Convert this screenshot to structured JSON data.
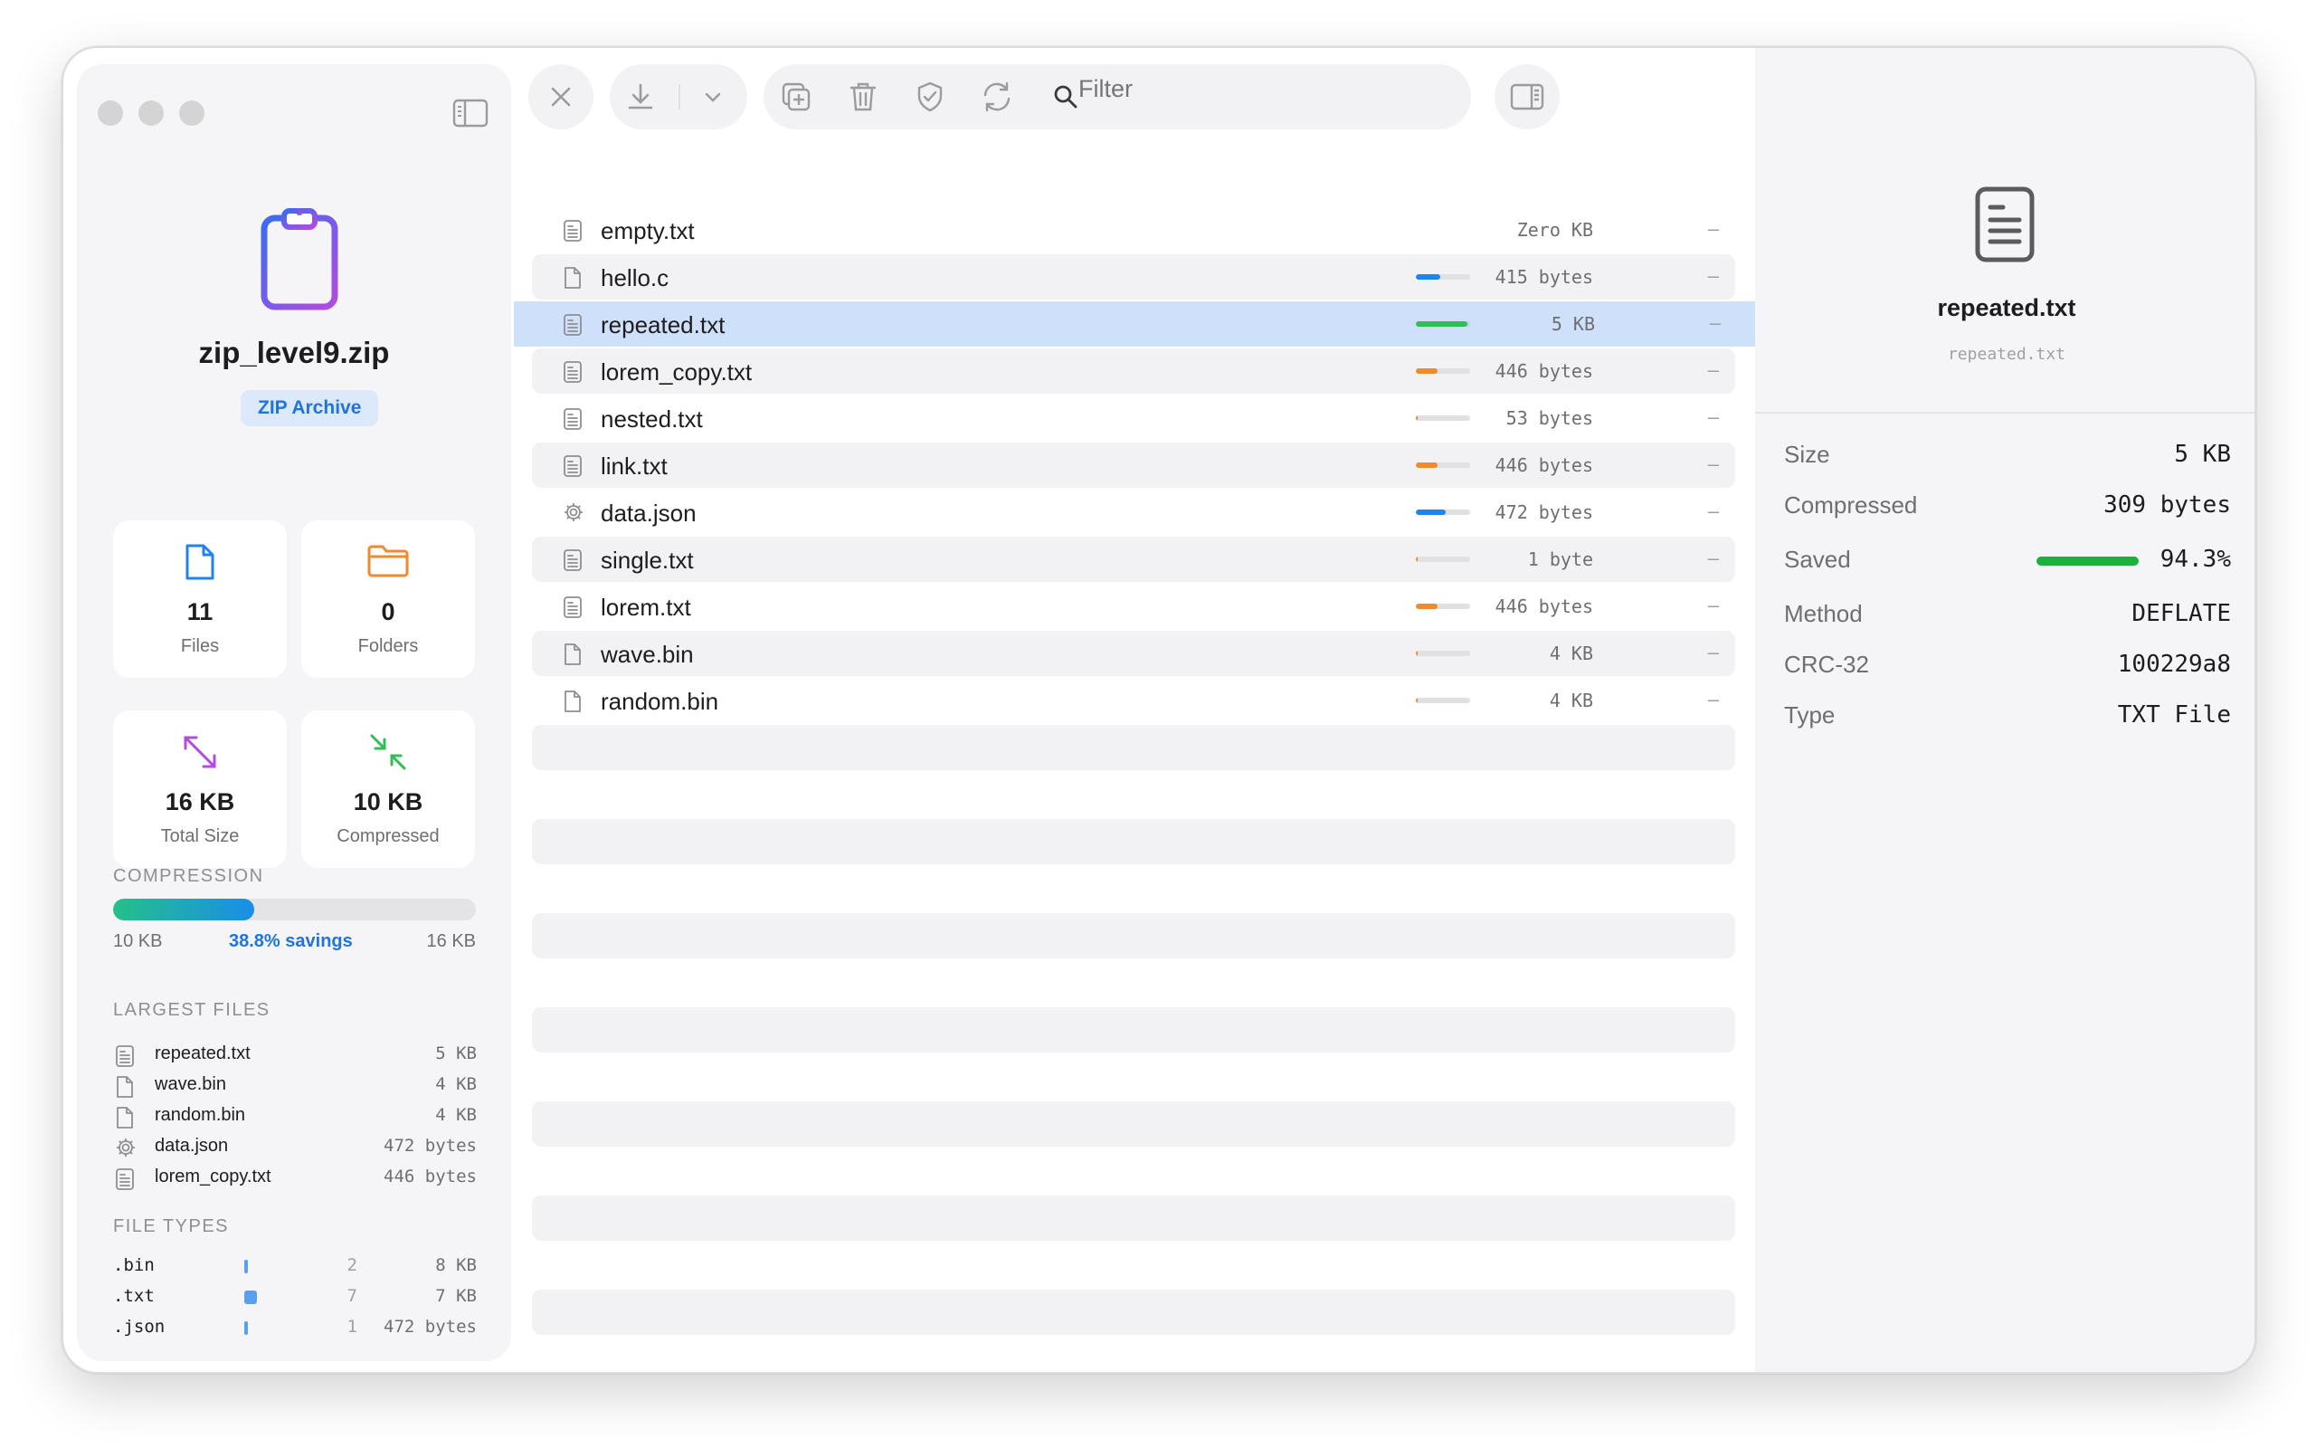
{
  "archive": {
    "name": "zip_level9.zip",
    "badge": "ZIP Archive"
  },
  "stats": [
    {
      "value": "11",
      "label": "Files",
      "icon": "file-icon"
    },
    {
      "value": "0",
      "label": "Folders",
      "icon": "folder-icon"
    },
    {
      "value": "16 KB",
      "label": "Total Size",
      "icon": "expand-arrows-icon"
    },
    {
      "value": "10 KB",
      "label": "Compressed",
      "icon": "compress-arrows-icon"
    }
  ],
  "compression": {
    "heading": "COMPRESSION",
    "left": "10 KB",
    "savings": "38.8% savings",
    "right": "16 KB",
    "fraction": 0.388
  },
  "largest": {
    "heading": "LARGEST FILES",
    "items": [
      {
        "name": "repeated.txt",
        "size": "5 KB",
        "icon": "text-file-icon"
      },
      {
        "name": "wave.bin",
        "size": "4 KB",
        "icon": "file-icon"
      },
      {
        "name": "random.bin",
        "size": "4 KB",
        "icon": "file-icon"
      },
      {
        "name": "data.json",
        "size": "472 bytes",
        "icon": "gear-icon"
      },
      {
        "name": "lorem_copy.txt",
        "size": "446 bytes",
        "icon": "text-file-icon"
      }
    ]
  },
  "filetypes": {
    "heading": "FILE TYPES",
    "items": [
      {
        "ext": ".bin",
        "count": "2",
        "size": "8 KB",
        "share": 0.12
      },
      {
        "ext": ".txt",
        "count": "7",
        "size": "7 KB",
        "share": 0.9
      },
      {
        "ext": ".json",
        "count": "1",
        "size": "472 bytes",
        "share": 0.1
      }
    ]
  },
  "toolbar": {
    "filter_placeholder": "Filter",
    "icons": [
      "close-icon",
      "download-icon",
      "chevron-down-icon",
      "add-file-icon",
      "trash-icon",
      "shield-icon",
      "refresh-icon",
      "search-icon",
      "inspector-toggle-icon"
    ]
  },
  "files": [
    {
      "name": "empty.txt",
      "size": "Zero KB",
      "dash": "–",
      "icon": "text-file-icon",
      "ratio": 0,
      "color": "#1e84f0"
    },
    {
      "name": "hello.c",
      "size": "415 bytes",
      "dash": "–",
      "icon": "file-icon",
      "ratio": 0.45,
      "color": "#1e84f0"
    },
    {
      "name": "repeated.txt",
      "size": "5 KB",
      "dash": "–",
      "icon": "text-file-icon",
      "ratio": 0.95,
      "color": "#2fbf55",
      "selected": true
    },
    {
      "name": "lorem_copy.txt",
      "size": "446 bytes",
      "dash": "–",
      "icon": "text-file-icon",
      "ratio": 0.4,
      "color": "#f08a2c"
    },
    {
      "name": "nested.txt",
      "size": "53 bytes",
      "dash": "–",
      "icon": "text-file-icon",
      "ratio": 0.04,
      "color": "#f08a2c"
    },
    {
      "name": "link.txt",
      "size": "446 bytes",
      "dash": "–",
      "icon": "text-file-icon",
      "ratio": 0.4,
      "color": "#f08a2c"
    },
    {
      "name": "data.json",
      "size": "472 bytes",
      "dash": "–",
      "icon": "gear-icon",
      "ratio": 0.55,
      "color": "#1e84f0"
    },
    {
      "name": "single.txt",
      "size": "1 byte",
      "dash": "–",
      "icon": "text-file-icon",
      "ratio": 0.04,
      "color": "#f08a2c"
    },
    {
      "name": "lorem.txt",
      "size": "446 bytes",
      "dash": "–",
      "icon": "text-file-icon",
      "ratio": 0.4,
      "color": "#f08a2c"
    },
    {
      "name": "wave.bin",
      "size": "4 KB",
      "dash": "–",
      "icon": "file-icon",
      "ratio": 0.04,
      "color": "#f08a2c"
    },
    {
      "name": "random.bin",
      "size": "4 KB",
      "dash": "–",
      "icon": "file-icon",
      "ratio": 0.04,
      "color": "#f08a2c"
    }
  ],
  "detail": {
    "name": "repeated.txt",
    "path": "repeated.txt",
    "rows": [
      {
        "key": "Size",
        "value": "5 KB"
      },
      {
        "key": "Compressed",
        "value": "309 bytes"
      },
      {
        "key": "Saved",
        "value": "94.3%"
      },
      {
        "key": "Method",
        "value": "DEFLATE"
      },
      {
        "key": "CRC-32",
        "value": "100229a8"
      },
      {
        "key": "Type",
        "value": "TXT File"
      }
    ],
    "saved_fraction": 0.943,
    "saved_color": "#1bb13c"
  },
  "colors": {
    "accent": "#1f74e0",
    "selection": "#cfe0fa",
    "zip_icon_gradient": [
      "#3b6df0",
      "#b24be0"
    ]
  }
}
